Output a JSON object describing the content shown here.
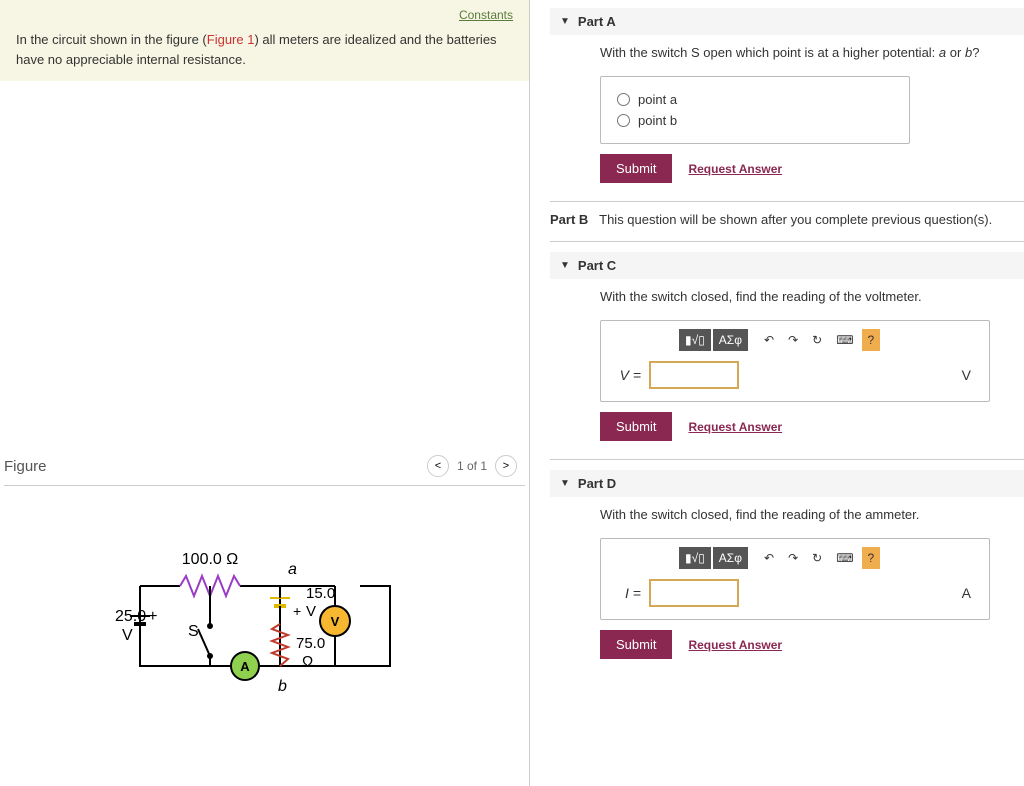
{
  "constants_link": "Constants",
  "problem_text_1": "In the circuit shown in the figure (",
  "figure_ref": "Figure 1",
  "problem_text_2": ") all meters are idealized and the batteries have no appreciable internal resistance.",
  "figure_title": "Figure",
  "figure_count": "1 of 1",
  "circuit": {
    "r_top": "100.0 Ω",
    "a": "a",
    "v1_label": "15.0",
    "v1_unit": "V",
    "v_left": "25.0",
    "v_left_unit": "V",
    "s": "S",
    "a_meter": "A",
    "v_meter": "V",
    "r_right": "75.0",
    "r_right_unit": "Ω",
    "b": "b",
    "plus1": "+",
    "plus2": "+"
  },
  "partA": {
    "title": "Part A",
    "question_1": "With the switch S open which point is at a higher potential: ",
    "a": "a",
    "or": " or ",
    "b": "b",
    "q_end": "?",
    "opt1_pre": "point ",
    "opt1": "a",
    "opt2_pre": "point ",
    "opt2": "b"
  },
  "submit": "Submit",
  "request": "Request Answer",
  "partB": {
    "label": "Part B",
    "text": "This question will be shown after you complete previous question(s)."
  },
  "partC": {
    "title": "Part C",
    "question": "With the switch closed, find the reading of the voltmeter.",
    "var": "V =",
    "unit": "V"
  },
  "partD": {
    "title": "Part D",
    "question": "With the switch closed, find the reading of the ammeter.",
    "var": "I =",
    "unit": "A"
  },
  "tools": {
    "frac": "▮√▯",
    "greek": "ΑΣφ",
    "undo": "↶",
    "redo": "↷",
    "reset": "↻",
    "kbd": "⌨",
    "help": "?"
  }
}
